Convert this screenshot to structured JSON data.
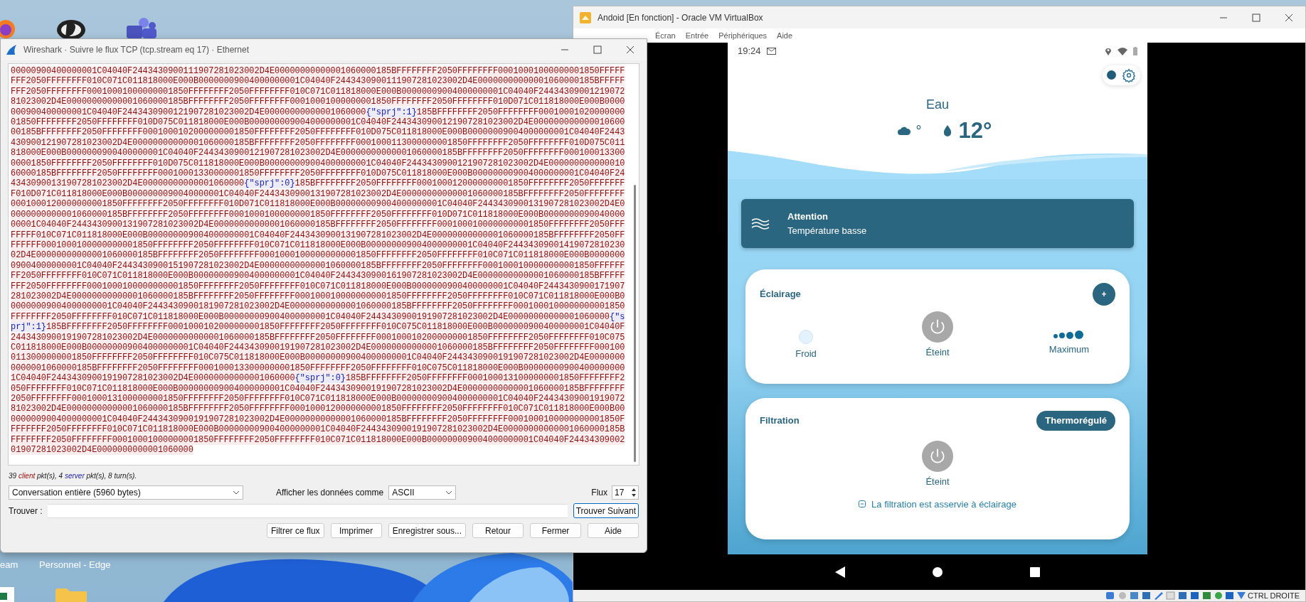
{
  "desktop": {
    "labels": [
      "eam",
      "Personnel - Edge"
    ]
  },
  "wireshark": {
    "title": "Wireshark · Suivre le flux TCP (tcp.stream eq 17) · Ethernet",
    "stream": [
      {
        "kind": "client",
        "text": "00000900400000001C04040F2443430900111907281023002D4E00000000000001060000185BFFFFFFFF2050FFFFFFFF00010001000000001850FFFFFFFF2050FFFFFFFF010C071C011818000E000B00000009004000000001C04040F2443430900111907281023002D4E00000000000001060000185BFFFFFFFF2050FFFFFFFF00010001000000001850FFFFFFFF2050FFFFFFFF010C071C011818000E000B00000009004000000001C04040F2443430900121907281023002D4E00000000000001060000185BFFFFFFFF2050FFFFFFFF00010001000000001850FFFFFFFF2050FFFFFFFF010D071C011818000E000B0000000900400000001C04040F2443430900121907281023002D4E00000000000001060000"
      },
      {
        "kind": "server",
        "text": "{\"sprj\":1}"
      },
      {
        "kind": "client",
        "text": "185BFFFFFFFF2050FFFFFFFF0001000102000000001850FFFFFFFF2050FFFFFFFF010D075C011818000E000B000000009004000000001C04040F2443430900121907281023002D4E00000000000001060000185BFFFFFFFF2050FFFFFFFF0001000102000000001850FFFFFFFF2050FFFFFFFF010D075C011818000E000B00000009004000000001C04040F2443430900121907281023002D4E00000000000001060000185BFFFFFFFF2050FFFFFFFF0001000113000000001850FFFFFFFF2050FFFFFFFF010D075C011818000E000B0000000900400000001C04040F2443430900121907281023002D4E00000000000001060000185BFFFFFFFF2050FFFFFFFF00010001330000001850FFFFFFFF2050FFFFFFFF010D075C011818000E000B000000009004000000001C04040F2443430900121907281023002D4E00000000000001060000185BFFFFFFFF2050FFFFFFFF00010001330000001850FFFFFFFF2050FFFFFFFF010D075C011818000E000B000000009004000000001C04040F2443430900131907281023002D4E00000000000001060000"
      },
      {
        "kind": "server",
        "text": "{\"sprj\":0}"
      },
      {
        "kind": "client",
        "text": "185BFFFFFFFF2050FFFFFFFF0001000120000000001850FFFFFFFF2050FFFFFFFF010D071C011818000E000B0000000090040000001C04040F2443430900131907281023002D4E00000000000001060000185BFFFFFFFF2050FFFFFFFF0001000120000000001850FFFFFFFF2050FFFFFFFF010D071C011818000E000B000000009004000000001C04040F2443430900131907281023002D4E00000000000001060000185BFFFFFFFF2050FFFFFFFF00010001000000001850FFFFFFFF2050FFFFFFFF010D071C011818000E000B000000009004000000001C04040F2443430900131907281023002D4E00000000000001060000185BFFFFFFFF2050FFFFFFFF0001000100000000001850FFFFFFFF2050FFFFFFFF010C071C011818000E000B000000009004000000001C04040F2443430900131907281023002D4E00000000000001060000185BFFFFFFFF2050FFFFFFFF0001000100000000001850FFFFFFFF2050FFFFFFFF010C071C011818000E000B000000009004000000001C04040F2443430900141907281023002D4E00000000000001060000185BFFFFFFFF2050FFFFFFFF00010001000000000001850FFFFFFFF2050FFFFFFFF010C071C011818000E000B000000009004000000001C04040F2443430900151907281023002D4E00000000000001060000185BFFFFFFFF2050FFFFFFFF0001000100000000001850FFFFFFFF2050FFFFFFFF010C071C011818000E000B000000009004000000001C04040F2443430900161907281023002D4E00000000000001060000185BFFFFFFFF2050FFFFFFFF0001000100000000001850FFFFFFFF2050FFFFFFFF010C071C011818000E000B0000000900400000001C04040F2443430900171907281023002D4E00000000000001060000185BFFFFFFFF2050FFFFFFFF0001000100000000001850FFFFFFFF2050FFFFFFFF010C071C011818000E000B000000009004000000001C04040F2443430900181907281023002D4E00000000000001060000185BFFFFFFFF2050FFFFFFFF0001000100000000001850FFFFFFFF2050FFFFFFFF010C071C011818000E000B000000009004000000001C04040F2443430900191907281023002D4E00000000000001060000"
      },
      {
        "kind": "server",
        "text": "{\"sprj\":1}"
      },
      {
        "kind": "client",
        "text": "185BFFFFFFFF2050FFFFFFFF0001000102000000001850FFFFFFFF2050FFFFFFFF010C075C011818000E000B0000000900400000001C04040F2443430900191907281023002D4E00000000000001060000185BFFFFFFFF2050FFFFFFFF0001000102000000001850FFFFFFFF2050FFFFFFFF010C075C011818000E000B000000009004000000001C04040F2443430900191907281023002D4E00000000000001060000185BFFFFFFFF2050FFFFFFFF0001000113000000001850FFFFFFFF2050FFFFFFFF010C075C011818000E000B000000009004000000001C04040F2443430900191907281023002D4E00000000000001060000185BFFFFFFFF2050FFFFFFFF0001000133000000001850FFFFFFFF2050FFFFFFFF010C075C011818000E000B000000009004000000001C04040F2443430900191907281023002D4E00000000000001060000"
      },
      {
        "kind": "server",
        "text": "{\"sprj\":0}"
      },
      {
        "kind": "client",
        "text": "185BFFFFFFFF2050FFFFFFFF0001000131000000001850FFFFFFFF2050FFFFFFFF010C071C011818000E000B000000009004000000001C04040F2443430900191907281023002D4E00000000000001060000185BFFFFFFFF2050FFFFFFFF0001000131000000001850FFFFFFFF2050FFFFFFFF010C071C011818000E000B000000009004000000001C04040F2443430900191907281023002D4E00000000000001060000185BFFFFFFFF2050FFFFFFFF0001000120000000001850FFFFFFFF2050FFFFFFFF010C071C011818000E000B000000009004000000001C04040F2443430900191907281023002D4E00000000000001060000185BFFFFFFFF2050FFFFFFFF0001000100000000001850FFFFFFFF2050FFFFFFFF010C071C011818000E000B000000009004000000001C04040F2443430900191907281023002D4E00000000000001060000185BFFFFFFFF2050FFFFFFFF00010001000000001850FFFFFFFF2050FFFFFFFF010C071C011818000E000B000000009004000000001C04040F2443430900201907281023002D4E0000000000001060000"
      }
    ],
    "stats": [
      {
        "kind": "plain",
        "text": "39 "
      },
      {
        "kind": "client",
        "text": "client"
      },
      {
        "kind": "plain",
        "text": " pkt(s), 4 "
      },
      {
        "kind": "server",
        "text": "server"
      },
      {
        "kind": "plain",
        "text": " pkt(s), 8 turn(s)."
      }
    ],
    "conversation_select": "Conversation entière (5960 bytes)",
    "show_as_label": "Afficher les données comme",
    "show_as_select": "ASCII",
    "flux_label": "Flux",
    "flux_value": "17",
    "find_label": "Trouver :",
    "find_button": {
      "label": "Trouver Suivant",
      "focused": true
    },
    "buttons": [
      "Filtrer ce flux",
      "Imprimer",
      "Enregistrer sous...",
      "Retour",
      "Fermer",
      "Aide"
    ]
  },
  "virtualbox": {
    "title": "Andoid [En fonction] - Oracle VM VirtualBox",
    "menu": [
      "Écran",
      "Entrée",
      "Périphériques",
      "Aide"
    ],
    "status_text": "CTRL DROITE",
    "android": {
      "time": "19:24",
      "theme_toggle": {
        "on": true
      },
      "water_label": "Eau",
      "air_temp": "°",
      "water_temp": "12°",
      "alert": {
        "title": "Attention",
        "message": "Température basse"
      },
      "lighting": {
        "title": "Éclairage",
        "add": "+",
        "modes": [
          {
            "kind": "color",
            "label": "Froid"
          },
          {
            "kind": "power",
            "label": "Éteint"
          },
          {
            "kind": "intensity",
            "label": "Maximum"
          }
        ]
      },
      "filtration": {
        "title": "Filtration",
        "mode": "Thermorégulé",
        "power_label": "Éteint",
        "note": "La filtration est asservie à éclairage"
      }
    }
  }
}
